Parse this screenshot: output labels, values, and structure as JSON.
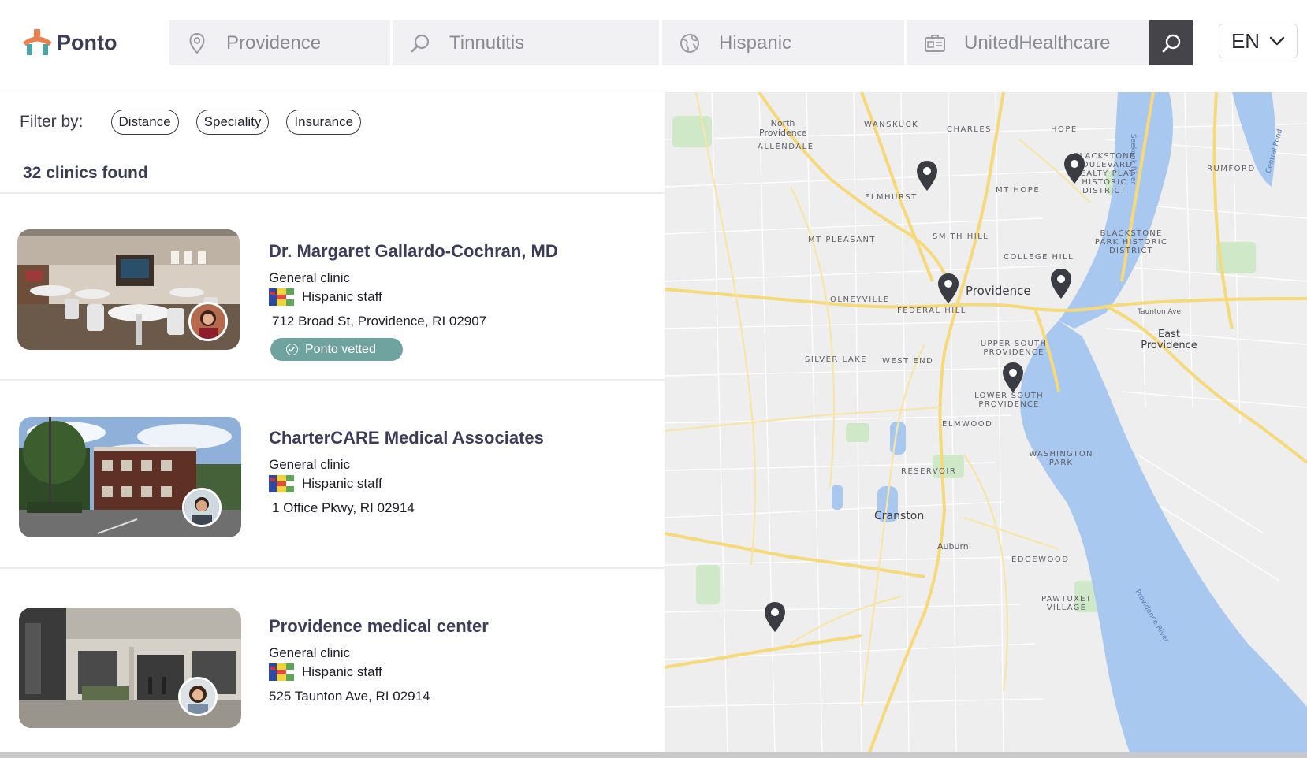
{
  "app": {
    "brand": "Ponto"
  },
  "search": {
    "location": "Providence",
    "condition": "Tinnutitis",
    "language": "Hispanic",
    "insurance": "UnitedHealthcare"
  },
  "lang": "EN",
  "filters": {
    "label": "Filter by:",
    "chips": [
      "Distance",
      "Speciality",
      "Insurance"
    ]
  },
  "results": {
    "count_text": "32 clinics found"
  },
  "clinics": [
    {
      "name": "Dr. Margaret Gallardo-Cochran, MD",
      "type": "General clinic",
      "staff": "Hispanic staff",
      "address": "712 Broad St, Providence, RI 02907",
      "badge": "Ponto vetted"
    },
    {
      "name": "CharterCARE Medical Associates",
      "type": "General clinic",
      "staff": "Hispanic staff",
      "address": "1 Office Pkwy, RI 02914"
    },
    {
      "name": "Providence medical center",
      "type": "General clinic",
      "staff": "Hispanic staff",
      "address": "525 Taunton Ave,  RI 02914"
    }
  ],
  "map": {
    "labels": {
      "north_providence": "North Providence",
      "allendale": "ALLENDALE",
      "wanskuck": "WANSKUCK",
      "charles": "CHARLES",
      "hope": "HOPE",
      "elmhurst": "ELMHURST",
      "mt_hope": "MT HOPE",
      "blackstone_blvd": "BLACKSTONE BOULEVARD REALTY PLAT HISTORIC DISTRICT",
      "rumford": "RUMFORD",
      "mt_pleasant": "MT PLEASANT",
      "smith_hill": "SMITH HILL",
      "blackstone_park": "BLACKSTONE PARK HISTORIC DISTRICT",
      "college_hill": "COLLEGE HILL",
      "providence": "Providence",
      "olneyville": "OLNEYVILLE",
      "federal_hill": "FEDERAL HILL",
      "taunton_ave": "Taunton Ave",
      "east_providence": "East Providence",
      "silver_lake": "SILVER LAKE",
      "west_end": "WEST END",
      "upper_south": "UPPER SOUTH PROVIDENCE",
      "lower_south": "LOWER SOUTH PROVIDENCE",
      "elmwood": "ELMWOOD",
      "washington_park": "WASHINGTON PARK",
      "reservoir": "RESERVOIR",
      "cranston": "Cranston",
      "auburn": "Auburn",
      "edgewood": "EDGEWOOD",
      "pawtuxet": "PAWTUXET VILLAGE",
      "providence_river": "Providence River",
      "seekonk_river": "Seekonk River",
      "central_pond": "Central Pond"
    }
  },
  "colors": {
    "brand": "#3c3c55",
    "vetted": "#6fa3a0",
    "search_button": "#444449",
    "water": "#a9c8ef",
    "road": "#f6d97a",
    "park": "#cfe8c8"
  },
  "icons": [
    "location-pin-icon",
    "search-icon",
    "globe-icon",
    "insurance-card-icon",
    "chevron-down-icon",
    "checkmark-circle-icon",
    "map-marker-icon"
  ]
}
